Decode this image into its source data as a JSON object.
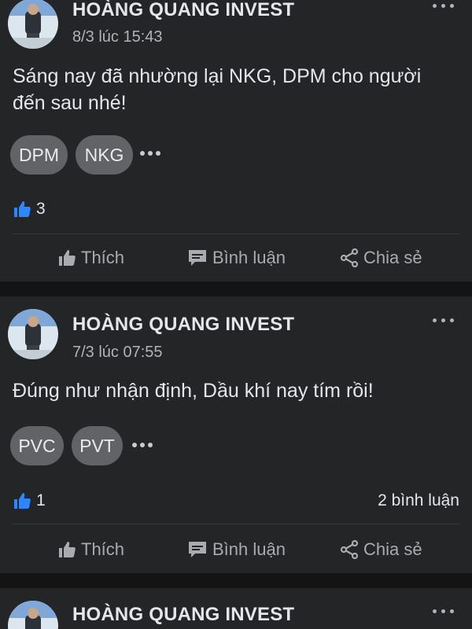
{
  "posts": [
    {
      "author": "HOÀNG QUANG INVEST",
      "time": "8/3 lúc 15:43",
      "content": "Sáng nay đã nhường lại NKG, DPM cho người đến sau nhé!",
      "tags": [
        "DPM",
        "NKG"
      ],
      "likes": "3",
      "comments": ""
    },
    {
      "author": "HOÀNG QUANG INVEST",
      "time": "7/3 lúc 07:55",
      "content": "Đúng như nhận định, Dầu khí nay tím rồi!",
      "tags": [
        "PVC",
        "PVT"
      ],
      "likes": "1",
      "comments": "2 bình luận"
    },
    {
      "author": "HOÀNG QUANG INVEST"
    }
  ],
  "actions": {
    "like": "Thích",
    "comment": "Bình luận",
    "share": "Chia sẻ"
  },
  "icons": {
    "more": "more-horizontal-icon",
    "like": "thumbs-up-icon",
    "comment": "comment-icon",
    "share": "share-icon"
  },
  "colors": {
    "background": "#141414",
    "card": "#242526",
    "tag": "#616366",
    "like_blue": "#2d88ff",
    "muted_text": "#b0b3b8"
  }
}
